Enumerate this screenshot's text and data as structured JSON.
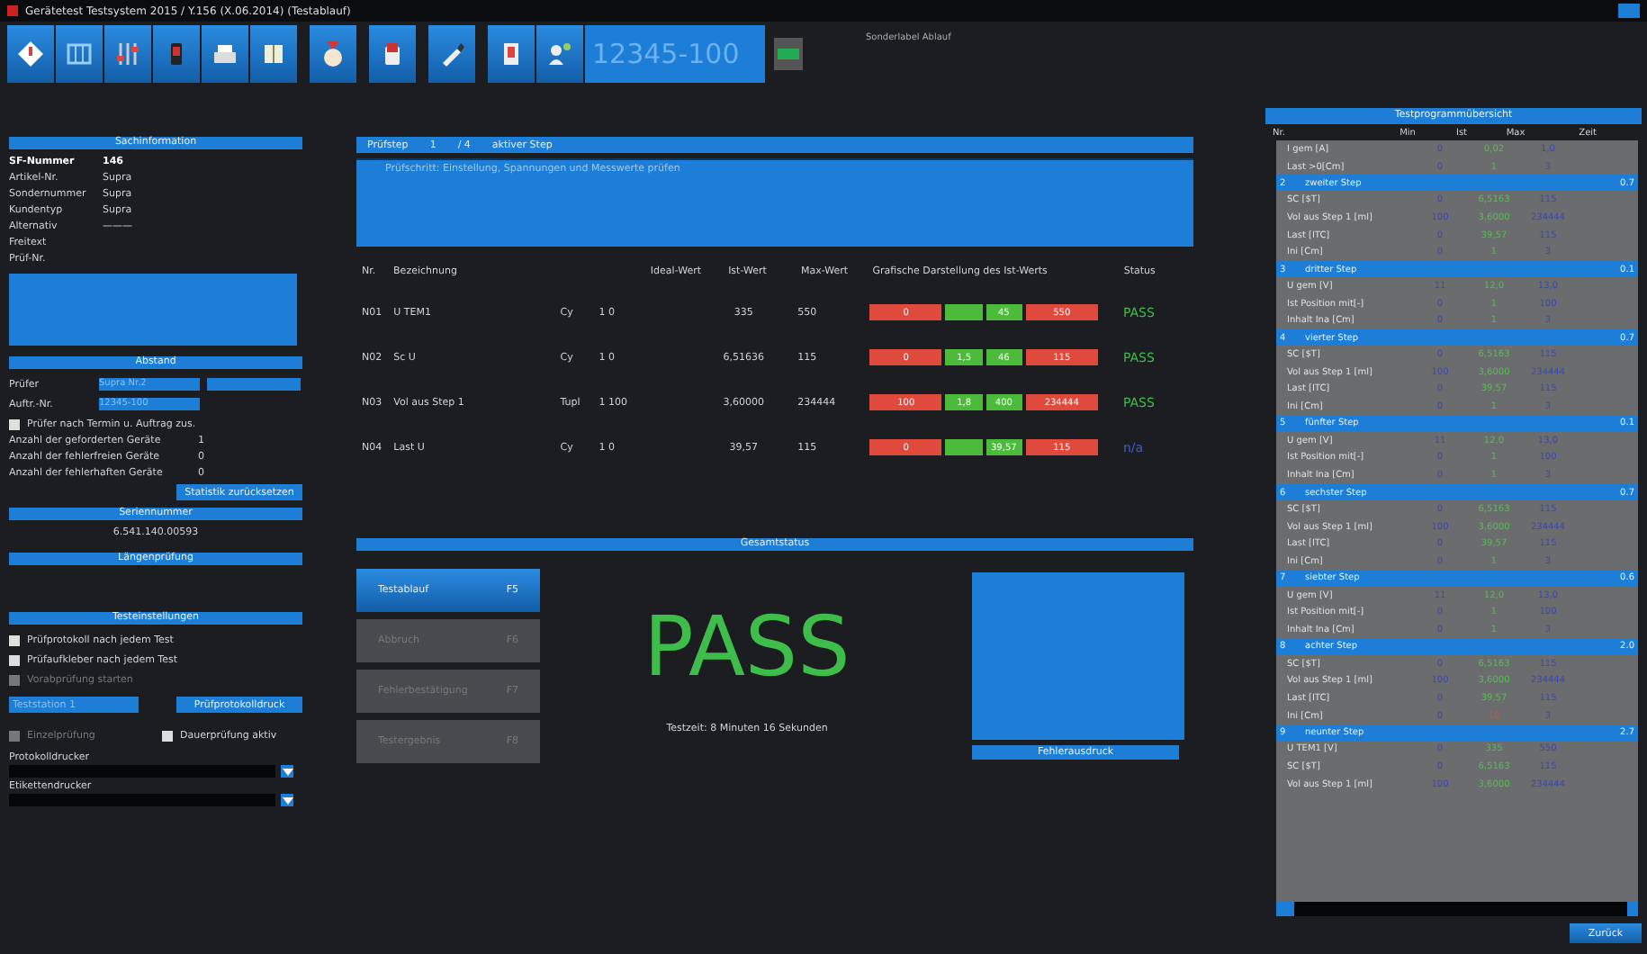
{
  "window": {
    "title": "Gerätetest Testsystem 2015 / Y.156  (X.06.2014) (Testablauf)"
  },
  "toolbar": {
    "order_field": "12345-100",
    "info": "Sonderlabel Ablauf"
  },
  "left": {
    "info_header": "Sachinformation",
    "info_rows": [
      {
        "label": "SF-Nummer",
        "value": "146",
        "bold": true
      },
      {
        "label": "Artikel-Nr.",
        "value": "Supra",
        "bold": false
      },
      {
        "label": "Sondernummer",
        "value": "Supra",
        "bold": false
      },
      {
        "label": "Kundentyp",
        "value": "Supra",
        "bold": false
      },
      {
        "label": "Alternativ",
        "value": "———",
        "bold": false
      },
      {
        "label": "Freitext",
        "bold": false
      },
      {
        "label": "Prüf-Nr.",
        "bold": false
      }
    ],
    "stats_header": "Abstand",
    "fields": [
      {
        "label": "Prüfer",
        "value": "Supra Nr.2"
      },
      {
        "label": "Auftr.-Nr.",
        "value": "12345-100"
      }
    ],
    "stats_checkbox": {
      "label": "Prüfer nach Termin u. Auftrag zus.",
      "checked": false
    },
    "counters": [
      {
        "label": "Anzahl der geforderten Geräte",
        "value": "1"
      },
      {
        "label": "Anzahl der fehlerfreien Geräte",
        "value": "0"
      },
      {
        "label": "Anzahl der fehlerhaften Geräte",
        "value": "0"
      }
    ],
    "reset_button": "Statistik zurücksetzen",
    "serial_header": "Seriennummer",
    "serial": "6.541.140.00593",
    "length_header": "Längenprüfung",
    "settings_header": "Testeinstellungen",
    "settings_checks": [
      {
        "label": "Prüfprotokoll nach jedem Test",
        "checked": false,
        "disabled": false
      },
      {
        "label": "Prüfaufkleber nach jedem Test",
        "checked": false,
        "disabled": false
      },
      {
        "label": "Vorabprüfung starten",
        "checked": false,
        "disabled": true
      }
    ],
    "station_field": "Teststation 1",
    "print_button": "Prüfprotokolldruck",
    "mode_checks": [
      {
        "label": "Einzelprüfung",
        "checked": false,
        "disabled": true
      },
      {
        "label": "Dauerprüfung aktiv",
        "checked": false,
        "disabled": false
      }
    ],
    "dropdowns": [
      {
        "label": "Protokolldrucker"
      },
      {
        "label": "Etikettendrucker"
      }
    ]
  },
  "center": {
    "step_bar": {
      "label": "Prüfstep",
      "current": "1",
      "total": "/ 4",
      "name": "aktiver Step"
    },
    "description": "Prüfschritt: Einstellung, Spannungen und Messwerte prüfen",
    "columns": [
      "Nr.",
      "Bezeichnung",
      "Ideal-Wert",
      "Ist-Wert",
      "Max-Wert",
      "Grafische Darstellung des Ist-Werts",
      "Status"
    ],
    "rows": [
      {
        "nr": "N01",
        "name": "U TEM1",
        "unit": "Cy",
        "ideal": "1 0",
        "ist": "335",
        "max": "550",
        "bar": [
          {
            "label": "0",
            "color": "#e04a3c"
          },
          {
            "color": "#4cba3a"
          },
          {
            "label": "45",
            "color": "#4cba3a"
          },
          {
            "label": "550",
            "color": "#e04a3c"
          }
        ],
        "status": {
          "text": "PASS",
          "color": "#3ebd4a"
        }
      },
      {
        "nr": "N02",
        "name": "Sc U",
        "unit": "Cy",
        "ideal": "1 0",
        "ist": "6,51636",
        "max": "115",
        "bar": [
          {
            "label": "0",
            "color": "#e04a3c"
          },
          {
            "label": "1,5",
            "color": "#4cba3a"
          },
          {
            "label": "46",
            "color": "#4cba3a"
          },
          {
            "label": "115",
            "color": "#e04a3c"
          }
        ],
        "status": {
          "text": "PASS",
          "color": "#3ebd4a"
        }
      },
      {
        "nr": "N03",
        "name": "Vol aus Step 1",
        "unit": "Tupl",
        "ideal": "1 100",
        "ist": "3,60000",
        "max": "234444",
        "bar": [
          {
            "label": "100",
            "color": "#e04a3c"
          },
          {
            "label": "1,8",
            "color": "#4cba3a"
          },
          {
            "label": "400",
            "color": "#4cba3a"
          },
          {
            "label": "234444",
            "color": "#e04a3c"
          }
        ],
        "status": {
          "text": "PASS",
          "color": "#3ebd4a"
        }
      },
      {
        "nr": "N04",
        "name": "Last U",
        "unit": "Cy",
        "ideal": "1 0",
        "ist": "39,57",
        "max": "115",
        "bar": [
          {
            "label": "0",
            "color": "#e04a3c"
          },
          {
            "color": "#4cba3a"
          },
          {
            "label": "39,57",
            "color": "#4cba3a"
          },
          {
            "label": "115",
            "color": "#e04a3c"
          }
        ],
        "status": {
          "text": "n/a",
          "color": "#3a5fd0"
        }
      }
    ],
    "overall_header": "Gesamtstatus",
    "actions": [
      {
        "label": "Testablauf",
        "key": "F5",
        "selected": true,
        "disabled": false
      },
      {
        "label": "Abbruch",
        "key": "F6",
        "selected": false,
        "disabled": true
      },
      {
        "label": "Fehlerbestätigung",
        "key": "F7",
        "selected": false,
        "disabled": true
      },
      {
        "label": "Testergebnis",
        "key": "F8",
        "selected": false,
        "disabled": true
      }
    ],
    "result": {
      "text": "PASS",
      "color": "#3ebd4a"
    },
    "duration": "Testzeit: 8 Minuten 16 Sekunden",
    "error_button": "Fehlerausdruck"
  },
  "right": {
    "header": "Testprogrammübersicht",
    "columns": [
      "Nr.",
      "Min",
      "Ist",
      "Max",
      "Zeit"
    ],
    "groups": [
      {
        "rows": [
          {
            "name": "I gem [A]",
            "min": "0",
            "ist": "0,02",
            "max": "1,0",
            "ok": true
          },
          {
            "name": "Last >0[Cm]",
            "min": "0",
            "ist": "1",
            "max": "3",
            "ok": true
          }
        ]
      },
      {
        "nr": "2",
        "title": "zweiter Step",
        "time": "0.7",
        "rows": [
          {
            "name": "SC [$T]",
            "min": "0",
            "ist": "6,5163",
            "max": "115",
            "ok": true
          },
          {
            "name": "Vol aus Step 1 [ml]",
            "min": "100",
            "ist": "3,6000",
            "max": "234444",
            "ok": true
          },
          {
            "name": "Last [ITC]",
            "min": "0",
            "ist": "39,57",
            "max": "115",
            "ok": true
          },
          {
            "name": "Ini [Cm]",
            "min": "0",
            "ist": "1",
            "max": "3",
            "ok": true
          }
        ]
      },
      {
        "nr": "3",
        "title": "dritter Step",
        "time": "0.1",
        "rows": [
          {
            "name": "U gem [V]",
            "min": "11",
            "ist": "12,0",
            "max": "13,0",
            "ok": true
          },
          {
            "name": "Ist Position mit[-]",
            "min": "0",
            "ist": "1",
            "max": "100",
            "ok": true
          },
          {
            "name": "Inhalt Ina [Cm]",
            "min": "0",
            "ist": "1",
            "max": "3",
            "ok": true
          }
        ]
      },
      {
        "nr": "4",
        "title": "vierter Step",
        "time": "0.7",
        "rows": [
          {
            "name": "SC [$T]",
            "min": "0",
            "ist": "6,5163",
            "max": "115",
            "ok": true
          },
          {
            "name": "Vol aus Step 1 [ml]",
            "min": "100",
            "ist": "3,6000",
            "max": "234444",
            "ok": true
          },
          {
            "name": "Last [ITC]",
            "min": "0",
            "ist": "39,57",
            "max": "115",
            "ok": true
          },
          {
            "name": "Ini [Cm]",
            "min": "0",
            "ist": "1",
            "max": "3",
            "ok": true
          }
        ]
      },
      {
        "nr": "5",
        "title": "fünfter Step",
        "time": "0.1",
        "rows": [
          {
            "name": "U gem [V]",
            "min": "11",
            "ist": "12,0",
            "max": "13,0",
            "ok": true
          },
          {
            "name": "Ist Position mit[-]",
            "min": "0",
            "ist": "1",
            "max": "100",
            "ok": true
          },
          {
            "name": "Inhalt Ina [Cm]",
            "min": "0",
            "ist": "1",
            "max": "3",
            "ok": true
          }
        ]
      },
      {
        "nr": "6",
        "title": "sechster Step",
        "time": "0.7",
        "rows": [
          {
            "name": "SC [$T]",
            "min": "0",
            "ist": "6,5163",
            "max": "115",
            "ok": true
          },
          {
            "name": "Vol aus Step 1 [ml]",
            "min": "100",
            "ist": "3,6000",
            "max": "234444",
            "ok": true
          },
          {
            "name": "Last [ITC]",
            "min": "0",
            "ist": "39,57",
            "max": "115",
            "ok": true
          },
          {
            "name": "Ini [Cm]",
            "min": "0",
            "ist": "1",
            "max": "3",
            "ok": true
          }
        ]
      },
      {
        "nr": "7",
        "title": "siebter Step",
        "time": "0.6",
        "rows": [
          {
            "name": "U gem [V]",
            "min": "11",
            "ist": "12,0",
            "max": "13,0",
            "ok": true
          },
          {
            "name": "Ist Position mit[-]",
            "min": "0",
            "ist": "1",
            "max": "100",
            "ok": true
          },
          {
            "name": "Inhalt Ina [Cm]",
            "min": "0",
            "ist": "1",
            "max": "3",
            "ok": true
          }
        ]
      },
      {
        "nr": "8",
        "title": "achter Step",
        "time": "2.0",
        "rows": [
          {
            "name": "SC [$T]",
            "min": "0",
            "ist": "6,5163",
            "max": "115",
            "ok": true
          },
          {
            "name": "Vol aus Step 1 [ml]",
            "min": "100",
            "ist": "3,6000",
            "max": "234444",
            "ok": true
          },
          {
            "name": "Last [ITC]",
            "min": "0",
            "ist": "39,57",
            "max": "115",
            "ok": true
          },
          {
            "name": "Ini [Cm]",
            "min": "0",
            "ist": "10",
            "max": "3",
            "ok": false
          }
        ]
      },
      {
        "nr": "9",
        "title": "neunter Step",
        "time": "2.7",
        "rows": [
          {
            "name": "U TEM1 [V]",
            "min": "0",
            "ist": "335",
            "max": "550",
            "ok": true
          },
          {
            "name": "SC [$T]",
            "min": "0",
            "ist": "6,5163",
            "max": "115",
            "ok": true
          },
          {
            "name": "Vol aus Step 1 [ml]",
            "min": "100",
            "ist": "3,6000",
            "max": "234444",
            "ok": true
          }
        ]
      }
    ],
    "back_button": "Zurück"
  }
}
